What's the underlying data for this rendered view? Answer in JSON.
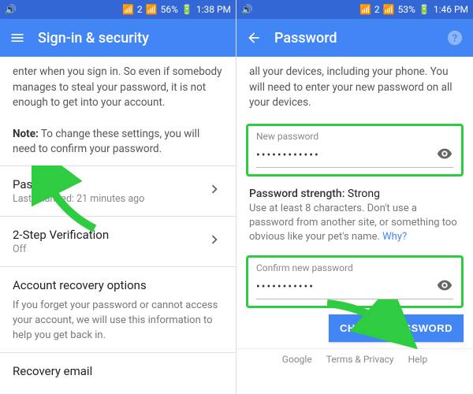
{
  "left": {
    "statusbar": {
      "volume": "🔊",
      "wifi": "📶",
      "sim": "2",
      "signal": "📶",
      "battery_pct": "56%",
      "battery": "🔋",
      "time": "1:38 PM"
    },
    "appbar": {
      "title": "Sign-in & security"
    },
    "intro_fragment": "enter when you sign in. So even if somebody manages to steal your password, it is not enough to get into your account.",
    "note_label": "Note:",
    "note_text": " To change these settings, you will need to confirm your password.",
    "rows": {
      "password": {
        "title": "Password",
        "sub": "Last changed: 21 minutes ago"
      },
      "twostep": {
        "title": "2-Step Verification",
        "sub": "Off"
      }
    },
    "recovery": {
      "heading": "Account recovery options",
      "desc": "If you forget your password or cannot access your account, we will use this information to help you get back in."
    },
    "recovery_email_row": "Recovery email"
  },
  "right": {
    "statusbar": {
      "volume": "🔊",
      "wifi": "📶",
      "sim": "2",
      "signal": "📶",
      "battery_pct": "53%",
      "battery": "🔋",
      "time": "1:46 PM"
    },
    "appbar": {
      "title": "Password"
    },
    "intro": "all your devices, including your phone. You will need to enter your new password on all your devices.",
    "new_password": {
      "label": "New password",
      "value": "••••••••••••"
    },
    "strength_label": "Password strength:",
    "strength_value": "Strong",
    "hint_text": "Use at least 8 characters. Don't use a password from another site, or something too obvious like your pet's name. ",
    "hint_link": "Why?",
    "confirm_password": {
      "label": "Confirm new password",
      "value": "•••••••••••"
    },
    "change_btn": "CHANGE PASSWORD",
    "footer": {
      "google": "Google",
      "terms": "Terms & Privacy",
      "help": "Help"
    }
  }
}
